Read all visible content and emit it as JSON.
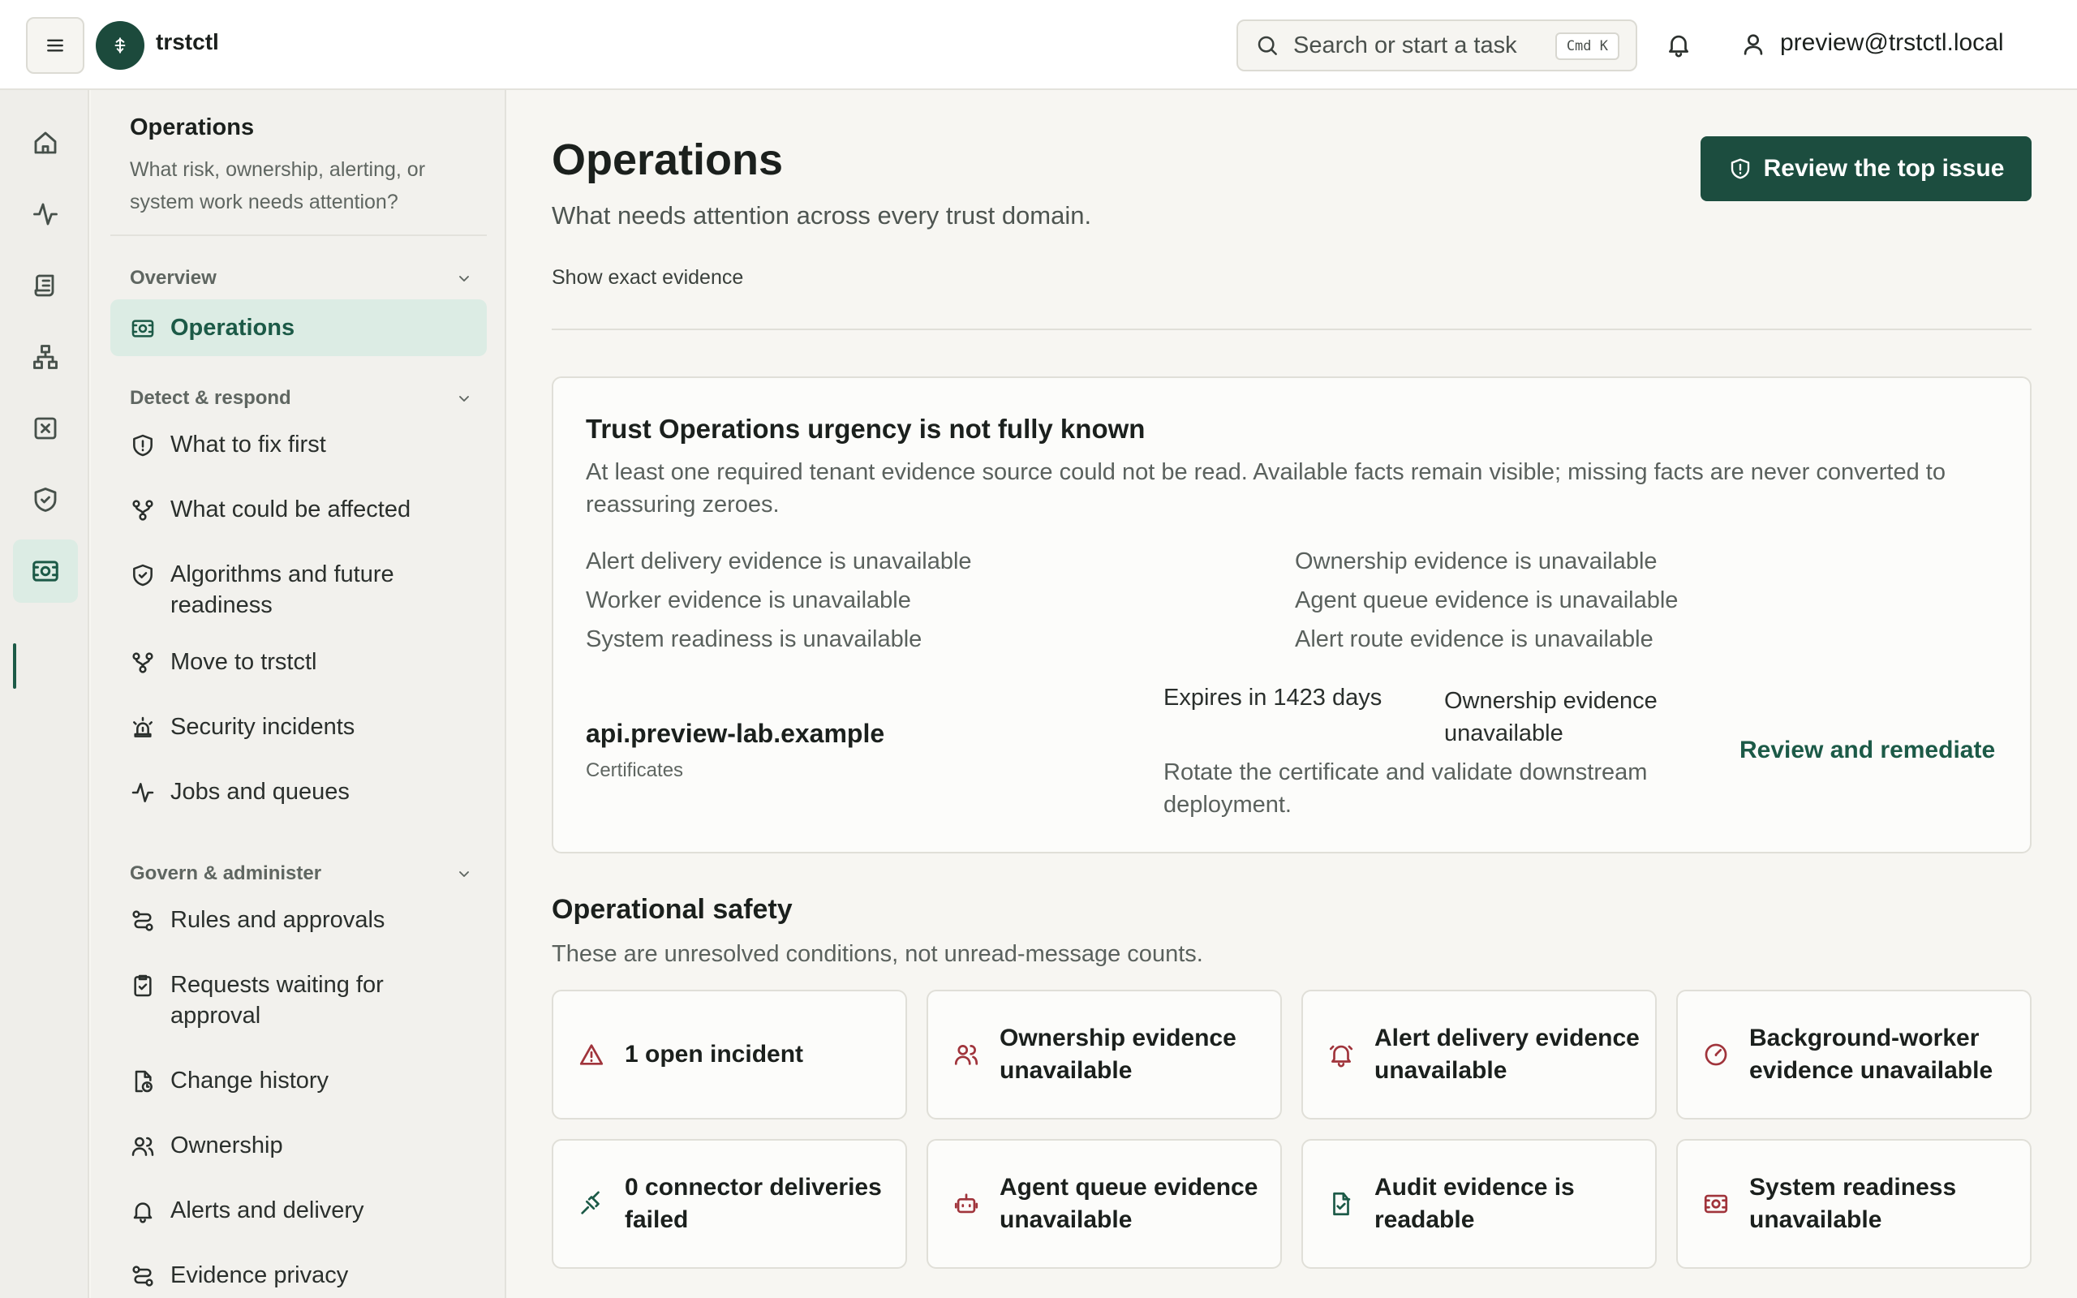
{
  "header": {
    "brand": "trstctl",
    "search_placeholder": "Search or start a task",
    "search_shortcut": "Cmd K",
    "user_email": "preview@trstctl.local"
  },
  "rail": {
    "icons": [
      "home-icon",
      "activity-icon",
      "scroll-icon",
      "network-icon",
      "x-square-icon",
      "shield-check-icon",
      "operations-icon"
    ]
  },
  "sidebar": {
    "title": "Operations",
    "description": "What risk, ownership, alerting, or system work needs attention?",
    "sections": [
      {
        "label": "Overview",
        "items": [
          {
            "label": "Operations",
            "icon": "operations-icon",
            "active": true
          }
        ]
      },
      {
        "label": "Detect & respond",
        "items": [
          {
            "label": "What to fix first",
            "icon": "shield-alert-icon"
          },
          {
            "label": "What could be affected",
            "icon": "branch-icon"
          },
          {
            "label": "Algorithms and future readiness",
            "icon": "shield-check-icon"
          },
          {
            "label": "Move to trstctl",
            "icon": "branch-icon"
          },
          {
            "label": "Security incidents",
            "icon": "siren-icon"
          },
          {
            "label": "Jobs and queues",
            "icon": "activity-icon"
          }
        ]
      },
      {
        "label": "Govern & administer",
        "items": [
          {
            "label": "Rules and approvals",
            "icon": "route-icon"
          },
          {
            "label": "Requests waiting for approval",
            "icon": "clipboard-check-icon"
          },
          {
            "label": "Change history",
            "icon": "file-clock-icon"
          },
          {
            "label": "Ownership",
            "icon": "users-icon"
          },
          {
            "label": "Alerts and delivery",
            "icon": "bell-icon"
          },
          {
            "label": "Evidence privacy",
            "icon": "route-icon"
          }
        ]
      }
    ]
  },
  "main": {
    "title": "Operations",
    "subtitle": "What needs attention across every trust domain.",
    "evidence_toggle": "Show exact evidence",
    "primary_action": "Review the top issue",
    "status_card": {
      "title": "Trust Operations urgency is not fully known",
      "body": "At least one required tenant evidence source could not be read. Available facts remain visible; missing facts are never converted to reassuring zeroes.",
      "gaps_left": [
        "Alert delivery evidence is unavailable",
        "Worker evidence is unavailable",
        "System readiness is unavailable"
      ],
      "gaps_right": [
        "Ownership evidence is unavailable",
        "Agent queue evidence is unavailable",
        "Alert route evidence is unavailable"
      ],
      "issue": {
        "host": "api.preview-lab.example",
        "category": "Certificates",
        "expiry": "Expires in 1423 days",
        "ownership": "Ownership evidence unavailable",
        "recommendation": "Rotate the certificate and validate downstream deployment.",
        "action": "Review and remediate"
      }
    },
    "safety": {
      "title": "Operational safety",
      "subtitle": "These are unresolved conditions, not unread-message counts.",
      "tiles": [
        {
          "label": "1 open incident",
          "icon": "alert-triangle-icon"
        },
        {
          "label": "Ownership evidence unavailable",
          "icon": "users-icon"
        },
        {
          "label": "Alert delivery evidence unavailable",
          "icon": "bell-ring-icon"
        },
        {
          "label": "Background-worker evidence unavailable",
          "icon": "gauge-icon"
        },
        {
          "label": "0 connector deliveries failed",
          "icon": "plug-icon"
        },
        {
          "label": "Agent queue evidence unavailable",
          "icon": "bot-icon"
        },
        {
          "label": "Audit evidence is readable",
          "icon": "file-check-icon"
        },
        {
          "label": "System readiness unavailable",
          "icon": "operations-icon"
        }
      ]
    }
  },
  "colors": {
    "accent": "#1c4d3f",
    "accent_soft": "#dcece4",
    "warning": "#a0343b",
    "background": "#f7f6f2"
  }
}
